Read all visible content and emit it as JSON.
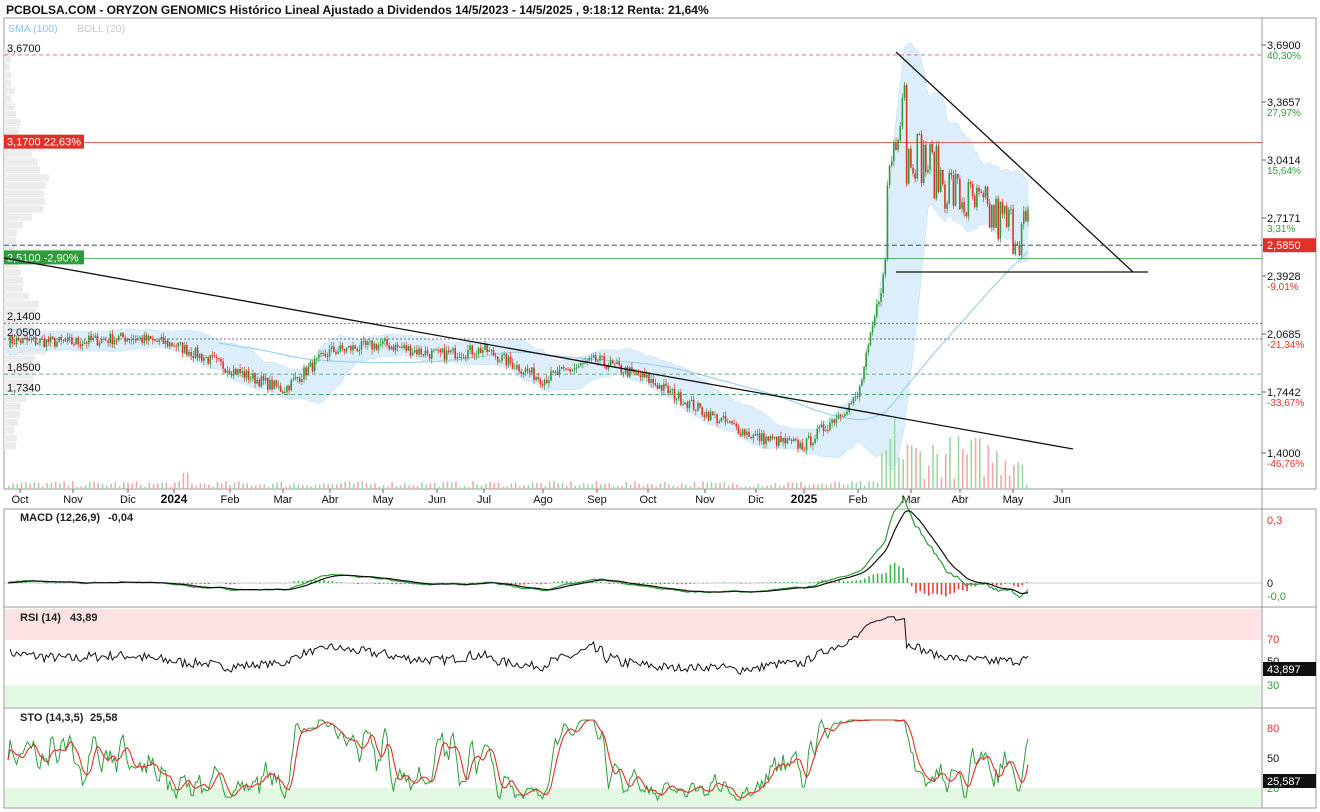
{
  "header": {
    "title": "PCBOLSA.COM - ORYZON GENOMICS Histórico Lineal Ajustado a Dividendos 14/5/2023 - 14/5/2025 , 9:18:12 Renta: 21,64%",
    "indicator_sma": "SMA (100)",
    "indicator_boll": "BOLL (20)"
  },
  "colors": {
    "up": "#2e9c3a",
    "down": "#e0302a",
    "sma": "#9fd0ea",
    "boll_fill": "#d6ecfb",
    "support_red": "#e0302a",
    "support_green": "#2e9c3a",
    "volume_up": "#9ad9a2",
    "volume_down": "#f3a7a7",
    "rsi_overbought": "#fde2e2",
    "rsi_oversold": "#e2f8e2"
  },
  "price_axis": {
    "labels": [
      "3,6900",
      "3,3657",
      "3,0414",
      "2,7171",
      "2,3928",
      "2,0685",
      "1,7442",
      "1,4000"
    ],
    "percent_labels": [
      "40,30%",
      "27,97%",
      "15,64%",
      "3,31%",
      "-9,01%",
      "-21,34%",
      "-33,67%",
      "-46,76%"
    ],
    "percent_colors": [
      "up",
      "up",
      "up",
      "up",
      "down",
      "down",
      "down",
      "down"
    ],
    "last_price": "2,5850"
  },
  "left_levels": [
    {
      "label": "3,6700",
      "style": "plain"
    },
    {
      "label": "3,1700  22,63%",
      "style": "red"
    },
    {
      "label": "2,5100  -2,90%",
      "style": "green"
    },
    {
      "label": "2,1400",
      "style": "plain"
    },
    {
      "label": "2,0500",
      "style": "plain"
    },
    {
      "label": "1,8500",
      "style": "plain"
    },
    {
      "label": "1,7340",
      "style": "plain"
    }
  ],
  "x_axis_labels": [
    "Oct",
    "Nov",
    "Dic",
    "2024",
    "Feb",
    "Mar",
    "Abr",
    "May",
    "Jun",
    "Jul",
    "Ago",
    "Sep",
    "Oct",
    "Nov",
    "Dic",
    "2025",
    "Feb",
    "Mar",
    "Abr",
    "May",
    "Jun"
  ],
  "macd": {
    "title": "MACD (12,26,9)",
    "value": "-0,04",
    "axis": [
      "0,3",
      "0",
      "-0,0"
    ]
  },
  "rsi": {
    "title": "RSI (14)",
    "value": "43,89",
    "axis": [
      "70",
      "50",
      "30"
    ],
    "current": "43,897"
  },
  "sto": {
    "title": "STO (14,3,5)",
    "value": "25,58",
    "axis": [
      "80",
      "50",
      "20"
    ],
    "current": "25,587"
  },
  "chart_data": {
    "type": "line",
    "title": "PCBOLSA.COM - ORYZON GENOMICS Histórico Lineal Ajustado a Dividendos 14/5/2023 - 14/5/2025 , 9:18:12 Renta: 21,64%",
    "ylim": [
      1.35,
      3.75
    ],
    "grid": false,
    "x": [
      "Oct",
      "Nov",
      "Dic",
      "2024",
      "Feb",
      "Mar",
      "Abr",
      "May",
      "Jun",
      "Jul",
      "Ago",
      "Sep",
      "Oct",
      "Nov",
      "Dic",
      "2025",
      "Feb",
      "Mar",
      "Abr",
      "May",
      "Jun"
    ],
    "series": [
      {
        "name": "ORYZON GENOMICS",
        "values": [
          2.04,
          2.03,
          2.06,
          2.02,
          1.88,
          1.76,
          1.98,
          2.02,
          1.96,
          1.99,
          1.82,
          1.93,
          1.82,
          1.63,
          1.49,
          1.44,
          1.72,
          3.15,
          2.85,
          2.68,
          null
        ]
      }
    ],
    "levels": [
      3.67,
      3.17,
      2.51,
      2.14,
      2.05,
      1.85,
      1.734
    ]
  }
}
